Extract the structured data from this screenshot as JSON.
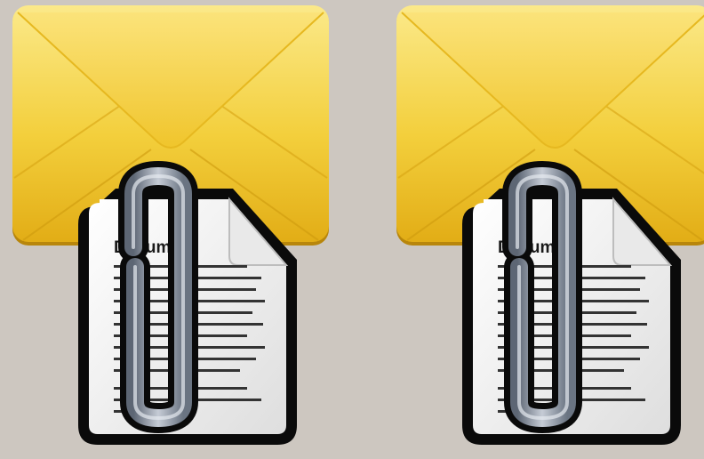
{
  "icons": [
    {
      "label": "Document",
      "icon": "mail-attachment-icon",
      "colors": {
        "background": "#cdc7c0",
        "envelope_light": "#f9e77a",
        "envelope_mid": "#f3cc35",
        "envelope_dark": "#d9a60f",
        "paper": "#f4f4f4",
        "outline": "#0a0a0a",
        "clip": "#8d97a5"
      }
    },
    {
      "label": "Document",
      "icon": "mail-attachment-icon",
      "colors": {
        "background": "#cdc7c0",
        "envelope_light": "#f9e77a",
        "envelope_mid": "#f3cc35",
        "envelope_dark": "#d9a60f",
        "paper": "#f4f4f4",
        "outline": "#0a0a0a",
        "clip": "#8d97a5"
      }
    }
  ]
}
